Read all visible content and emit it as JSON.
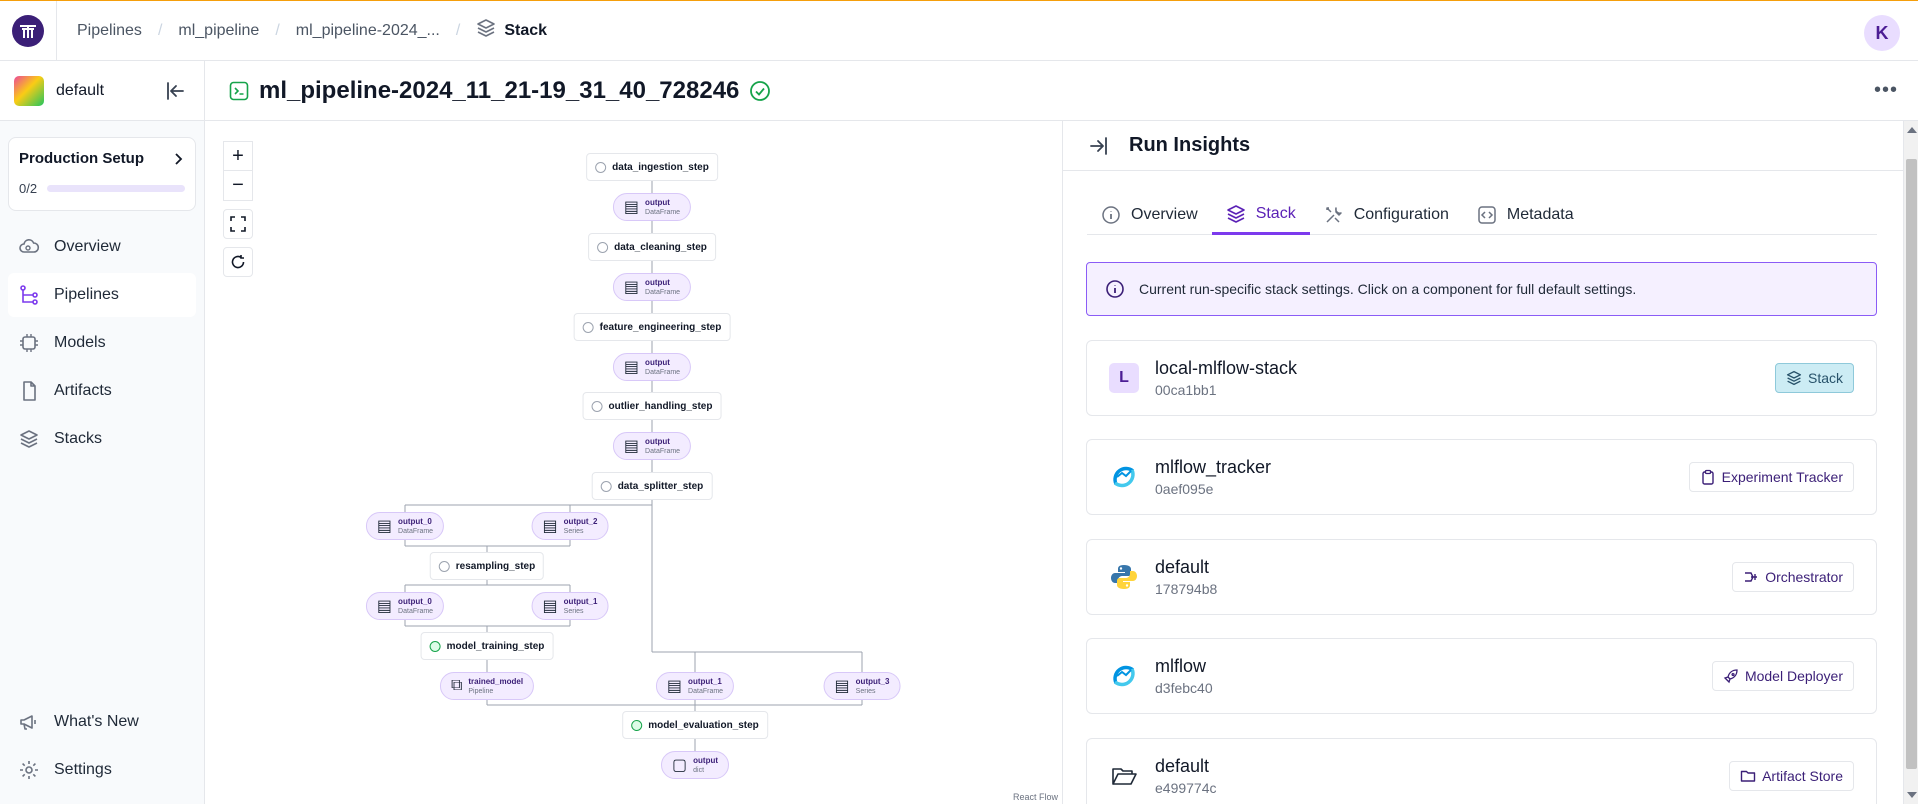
{
  "breadcrumbs": {
    "items": [
      "Pipelines",
      "ml_pipeline",
      "ml_pipeline-2024_..."
    ],
    "current": "Stack",
    "current_icon": "stack-icon"
  },
  "user": {
    "initial": "K"
  },
  "workspace": {
    "name": "default"
  },
  "setup": {
    "title": "Production Setup",
    "progress_text": "0/2",
    "progress_fraction": 0.0
  },
  "nav": {
    "items": [
      {
        "label": "Overview",
        "icon": "cloud-icon"
      },
      {
        "label": "Pipelines",
        "icon": "pipeline-icon",
        "active": true
      },
      {
        "label": "Models",
        "icon": "chip-icon"
      },
      {
        "label": "Artifacts",
        "icon": "file-icon"
      },
      {
        "label": "Stacks",
        "icon": "stack-icon"
      }
    ],
    "bottom": [
      {
        "label": "What's New",
        "icon": "megaphone-icon"
      },
      {
        "label": "Settings",
        "icon": "gear-icon"
      }
    ]
  },
  "run": {
    "title": "ml_pipeline-2024_11_21-19_31_40_728246",
    "status": "completed"
  },
  "dag": {
    "steps": [
      "data_ingestion_step",
      "data_cleaning_step",
      "feature_engineering_step",
      "outlier_handling_step",
      "data_splitter_step",
      "resampling_step",
      "model_training_step",
      "model_evaluation_step"
    ],
    "artifacts": [
      {
        "name": "output",
        "type": "DataFrame"
      },
      {
        "name": "output",
        "type": "DataFrame"
      },
      {
        "name": "output",
        "type": "DataFrame"
      },
      {
        "name": "output",
        "type": "DataFrame"
      },
      {
        "name": "output_0",
        "type": "DataFrame"
      },
      {
        "name": "output_2",
        "type": "Series"
      },
      {
        "name": "output_0",
        "type": "DataFrame"
      },
      {
        "name": "output_1",
        "type": "Series"
      },
      {
        "name": "trained_model",
        "type": "Pipeline"
      },
      {
        "name": "output_1",
        "type": "DataFrame"
      },
      {
        "name": "output_3",
        "type": "Series"
      },
      {
        "name": "output",
        "type": "dict"
      }
    ],
    "attribution": "React Flow"
  },
  "panel": {
    "title": "Run Insights",
    "tabs": [
      {
        "label": "Overview",
        "icon": "info-icon"
      },
      {
        "label": "Stack",
        "icon": "stack-icon",
        "active": true
      },
      {
        "label": "Configuration",
        "icon": "tools-icon"
      },
      {
        "label": "Metadata",
        "icon": "code-icon"
      }
    ],
    "info": "Current run-specific stack settings. Click on a component for full default settings.",
    "stack": {
      "letter": "L",
      "name": "local-mlflow-stack",
      "id": "00ca1bb1",
      "badge": "Stack"
    },
    "components": [
      {
        "name": "mlflow_tracker",
        "id": "0aef095e",
        "badge": "Experiment Tracker",
        "icon": "mlflow-icon",
        "badge_icon": "clipboard-icon"
      },
      {
        "name": "default",
        "id": "178794b8",
        "badge": "Orchestrator",
        "icon": "python-icon",
        "badge_icon": "orchestrator-icon"
      },
      {
        "name": "mlflow",
        "id": "d3febc40",
        "badge": "Model Deployer",
        "icon": "mlflow-icon",
        "badge_icon": "rocket-icon"
      },
      {
        "name": "default",
        "id": "e499774c",
        "badge": "Artifact Store",
        "icon": "folder-open-icon",
        "badge_icon": "folder-icon"
      }
    ]
  },
  "colors": {
    "accent": "#7c3aed",
    "brand": "#3b1f77",
    "success": "#16a34a",
    "warning_line": "#f59e0b"
  }
}
